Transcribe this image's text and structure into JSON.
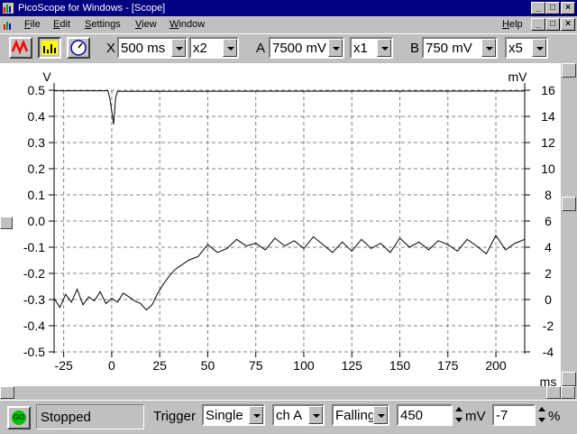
{
  "window": {
    "title": "PicoScope for Windows - [Scope]"
  },
  "menu": {
    "items": [
      "File",
      "Edit",
      "Settings",
      "View",
      "Window"
    ],
    "help": "Help"
  },
  "toolbar": {
    "x_label": "X",
    "timebase": "500 ms",
    "x_mult": "x2",
    "a_label": "A",
    "a_range": "7500 mV",
    "a_mult": "x1",
    "b_label": "B",
    "b_range": "750 mV",
    "b_mult": "x5"
  },
  "status": {
    "go_label": "GO",
    "state": "Stopped",
    "trigger_label": "Trigger",
    "trigger_mode": "Single",
    "trigger_channel": "ch A",
    "trigger_edge": "Falling",
    "trigger_level": "450",
    "level_unit": "mV",
    "pretrigger": "-7",
    "pretrigger_unit": "%"
  },
  "colors": {
    "title_bg": "#000080",
    "face": "#c0c0c0",
    "trace": "#000000",
    "grid": "#808080"
  },
  "chart_data": {
    "type": "line",
    "xlabel": "ms",
    "ylabel_left": "V",
    "ylabel_right": "mV",
    "xlim": [
      -30,
      215
    ],
    "xticks": [
      -25,
      0,
      25,
      50,
      75,
      100,
      125,
      150,
      175,
      200
    ],
    "yleft_lim": [
      -0.5,
      0.5
    ],
    "yleft_ticks": [
      "0.5",
      "0.4",
      "0.3",
      "0.2",
      "0.1",
      "0.0",
      "-0.1",
      "-0.2",
      "-0.3",
      "-0.4",
      "-0.5"
    ],
    "yright_lim": [
      -4,
      16
    ],
    "yright_ticks": [
      "16",
      "14",
      "12",
      "10",
      "8",
      "6",
      "4",
      "2",
      "0",
      "-2",
      "-4"
    ],
    "grid": true,
    "series": [
      {
        "axis": "left",
        "x": [
          -30,
          -2,
          -1,
          0,
          1,
          2,
          3,
          215
        ],
        "y": [
          0.498,
          0.498,
          0.47,
          0.42,
          0.37,
          0.47,
          0.496,
          0.497
        ]
      },
      {
        "axis": "right",
        "x": [
          -30,
          -27,
          -24,
          -21,
          -18,
          -15,
          -12,
          -9,
          -6,
          -3,
          0,
          3,
          6,
          9,
          12,
          15,
          18,
          21,
          24,
          27,
          30,
          33,
          36,
          40,
          45,
          50,
          55,
          60,
          65,
          70,
          75,
          80,
          85,
          90,
          95,
          100,
          105,
          110,
          115,
          120,
          125,
          130,
          135,
          140,
          145,
          150,
          155,
          160,
          165,
          170,
          175,
          180,
          185,
          190,
          195,
          200,
          205,
          210,
          215
        ],
        "y": [
          0.1,
          -0.6,
          0.4,
          -0.2,
          0.8,
          -0.4,
          0.2,
          -0.1,
          0.6,
          -0.3,
          0.1,
          -0.2,
          0.5,
          0.2,
          -0.1,
          -0.3,
          -0.8,
          -0.4,
          0.5,
          1.2,
          1.8,
          2.3,
          2.6,
          3.0,
          3.3,
          4.2,
          3.6,
          3.9,
          4.6,
          4.1,
          4.3,
          3.8,
          4.7,
          4.1,
          4.5,
          3.9,
          4.8,
          4.2,
          3.6,
          4.4,
          3.7,
          4.6,
          3.9,
          4.3,
          3.6,
          4.7,
          4.0,
          4.4,
          3.8,
          4.5,
          4.2,
          3.7,
          4.6,
          4.1,
          3.5,
          4.9,
          3.8,
          4.3,
          4.6
        ]
      }
    ]
  }
}
